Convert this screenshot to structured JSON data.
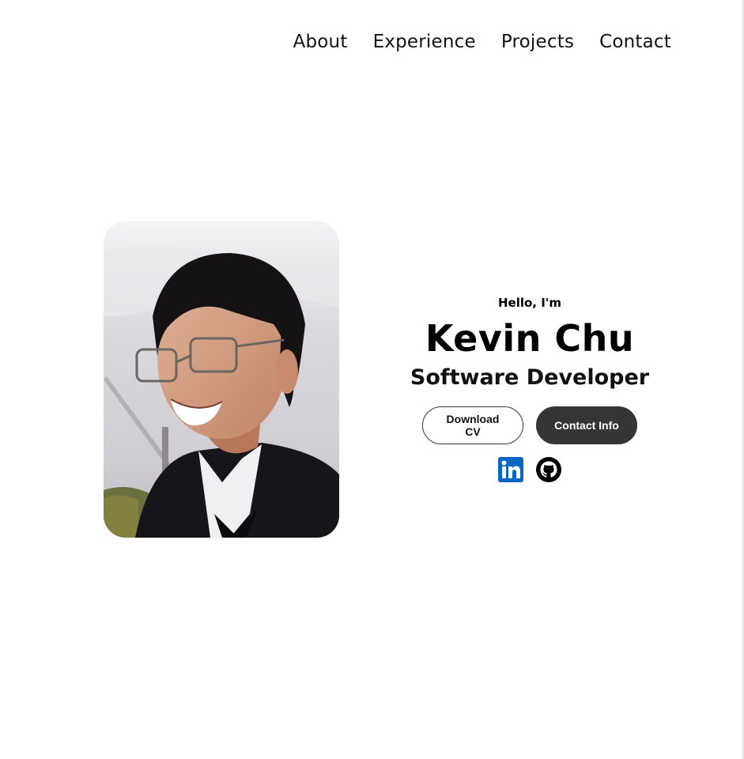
{
  "nav": {
    "items": [
      {
        "label": "About"
      },
      {
        "label": "Experience"
      },
      {
        "label": "Projects"
      },
      {
        "label": "Contact"
      }
    ]
  },
  "hero": {
    "greeting": "Hello, I'm",
    "name": "Kevin Chu",
    "role": "Software Developer",
    "buttons": {
      "download_cv": "Download CV",
      "contact_info": "Contact Info"
    },
    "social": {
      "linkedin_icon": "linkedin-icon",
      "github_icon": "github-icon",
      "linkedin_color": "#0a66c2",
      "github_color": "#000000"
    },
    "photo": {
      "icon": "profile-photo"
    }
  },
  "colors": {
    "solid_button": "#353535",
    "text": "#000000",
    "background": "#ffffff"
  }
}
